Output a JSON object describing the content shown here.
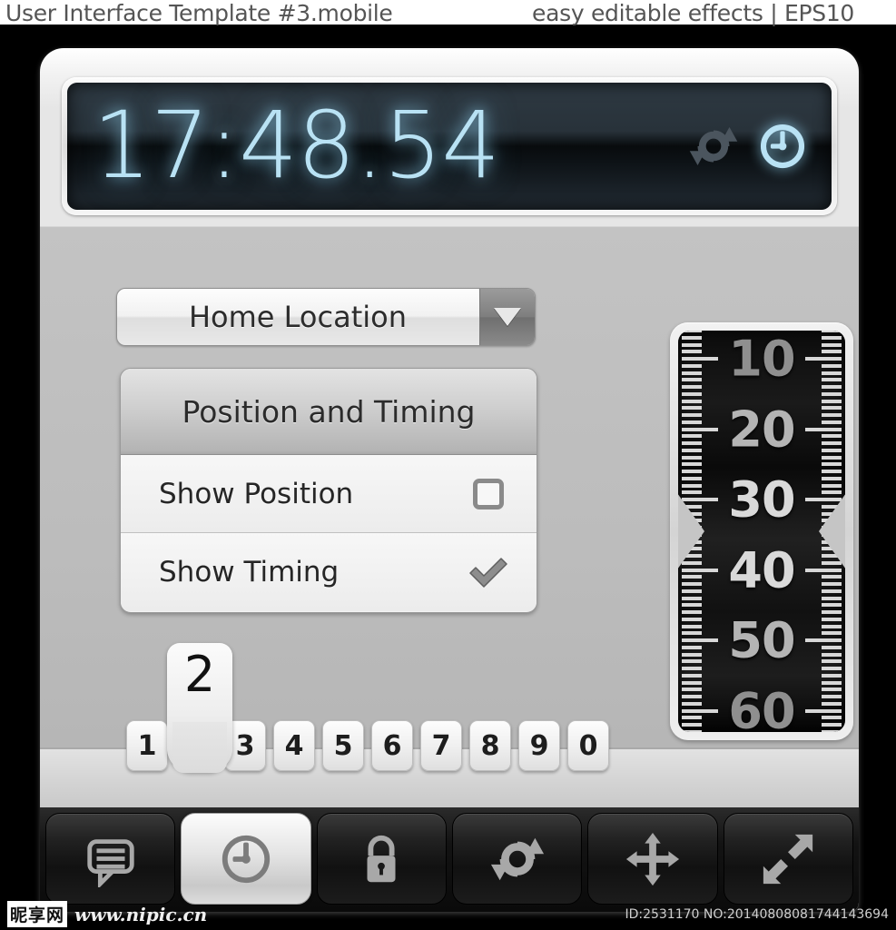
{
  "caption": {
    "left": "User Interface Template #3.mobile",
    "right": "easy editable effects | EPS10"
  },
  "display": {
    "time": "17:48.54",
    "icons": [
      {
        "name": "refresh-icon",
        "state": "inactive"
      },
      {
        "name": "clock-icon",
        "state": "active",
        "color": "#b9e2f4"
      }
    ]
  },
  "dropdown": {
    "value": "Home Location",
    "arrow": "chevron-down-icon"
  },
  "panel": {
    "title": "Position and Timing",
    "rows": [
      {
        "label": "Show Position",
        "control": "checkbox",
        "checked": false
      },
      {
        "label": "Show Timing",
        "control": "checkmark",
        "checked": true
      }
    ]
  },
  "keypad": {
    "keys": [
      "1",
      "2",
      "3",
      "4",
      "5",
      "6",
      "7",
      "8",
      "9",
      "0"
    ],
    "pressed": "2",
    "popup_label": "2"
  },
  "gauge": {
    "labels": [
      "10",
      "20",
      "30",
      "40",
      "50",
      "60"
    ],
    "min": 10,
    "max": 60,
    "indicator_value": 35,
    "minor_tick_step": 1
  },
  "toolbar": {
    "buttons": [
      {
        "name": "chat-icon",
        "label": "Messages",
        "active": false
      },
      {
        "name": "clock-icon",
        "label": "Timer",
        "active": true
      },
      {
        "name": "lock-icon",
        "label": "Lock",
        "active": false
      },
      {
        "name": "refresh-icon",
        "label": "Refresh",
        "active": false
      },
      {
        "name": "move-icon",
        "label": "Move",
        "active": false
      },
      {
        "name": "collapse-icon",
        "label": "Collapse",
        "active": false
      }
    ]
  },
  "watermark": {
    "logo_cn": "昵享网",
    "url": "www.nipic.cn",
    "id": "ID:2531170 NO:20140808081744143694"
  },
  "colors": {
    "background": "#000000",
    "bezel": "#ededed",
    "panel": "#bcbcbc",
    "lcd_text": "#b9e2f4",
    "toolbar": "#121212"
  }
}
